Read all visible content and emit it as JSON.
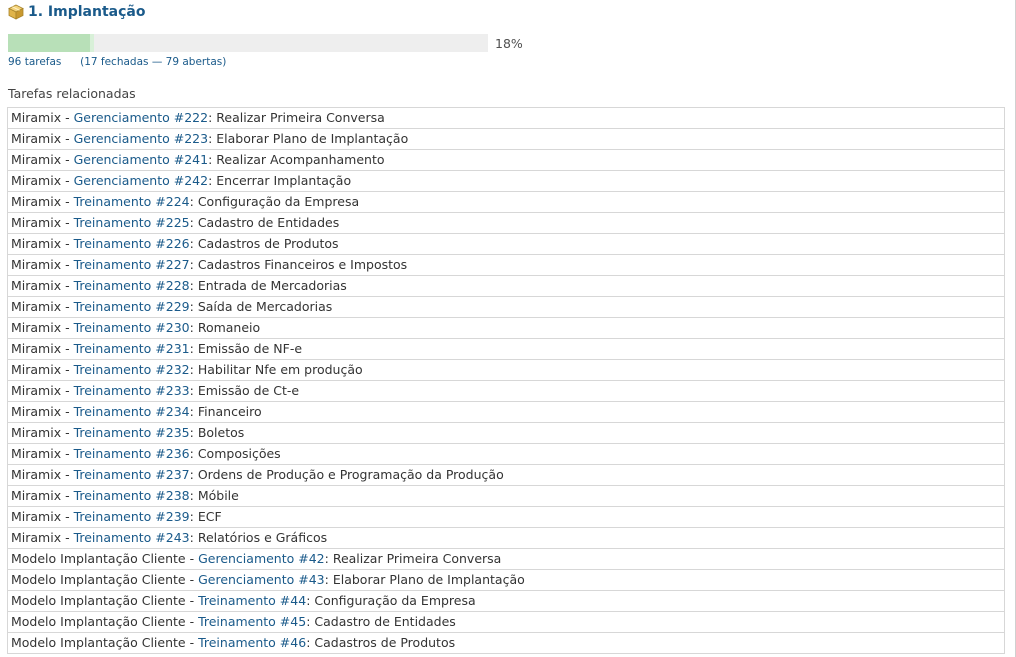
{
  "version": {
    "title": "1. Implantação",
    "icon": "package-icon",
    "progress": {
      "closed_fraction": 0.17,
      "done_fraction": 0.18,
      "percent_label": "18%"
    },
    "counts": {
      "total": "96 tarefas",
      "detail": "(17 fechadas — 79 abertas)"
    }
  },
  "related": {
    "label": "Tarefas relacionadas",
    "rows": [
      {
        "project": "Miramix",
        "tracker_link": "Gerenciamento #222",
        "subject": "Realizar Primeira Conversa"
      },
      {
        "project": "Miramix",
        "tracker_link": "Gerenciamento #223",
        "subject": "Elaborar Plano de Implantação"
      },
      {
        "project": "Miramix",
        "tracker_link": "Gerenciamento #241",
        "subject": "Realizar Acompanhamento"
      },
      {
        "project": "Miramix",
        "tracker_link": "Gerenciamento #242",
        "subject": "Encerrar Implantação"
      },
      {
        "project": "Miramix",
        "tracker_link": "Treinamento #224",
        "subject": "Configuração da Empresa"
      },
      {
        "project": "Miramix",
        "tracker_link": "Treinamento #225",
        "subject": "Cadastro de Entidades"
      },
      {
        "project": "Miramix",
        "tracker_link": "Treinamento #226",
        "subject": "Cadastros de Produtos"
      },
      {
        "project": "Miramix",
        "tracker_link": "Treinamento #227",
        "subject": "Cadastros Financeiros e Impostos"
      },
      {
        "project": "Miramix",
        "tracker_link": "Treinamento #228",
        "subject": "Entrada de Mercadorias"
      },
      {
        "project": "Miramix",
        "tracker_link": "Treinamento #229",
        "subject": "Saída de Mercadorias"
      },
      {
        "project": "Miramix",
        "tracker_link": "Treinamento #230",
        "subject": "Romaneio"
      },
      {
        "project": "Miramix",
        "tracker_link": "Treinamento #231",
        "subject": "Emissão de NF-e"
      },
      {
        "project": "Miramix",
        "tracker_link": "Treinamento #232",
        "subject": "Habilitar Nfe em produção"
      },
      {
        "project": "Miramix",
        "tracker_link": "Treinamento #233",
        "subject": "Emissão de Ct-e"
      },
      {
        "project": "Miramix",
        "tracker_link": "Treinamento #234",
        "subject": "Financeiro"
      },
      {
        "project": "Miramix",
        "tracker_link": "Treinamento #235",
        "subject": "Boletos"
      },
      {
        "project": "Miramix",
        "tracker_link": "Treinamento #236",
        "subject": "Composições"
      },
      {
        "project": "Miramix",
        "tracker_link": "Treinamento #237",
        "subject": "Ordens de Produção e Programação da Produção"
      },
      {
        "project": "Miramix",
        "tracker_link": "Treinamento #238",
        "subject": "Móbile"
      },
      {
        "project": "Miramix",
        "tracker_link": "Treinamento #239",
        "subject": "ECF"
      },
      {
        "project": "Miramix",
        "tracker_link": "Treinamento #243",
        "subject": "Relatórios e Gráficos"
      },
      {
        "project": "Modelo Implantação Cliente",
        "tracker_link": "Gerenciamento #42",
        "subject": "Realizar Primeira Conversa"
      },
      {
        "project": "Modelo Implantação Cliente",
        "tracker_link": "Gerenciamento #43",
        "subject": "Elaborar Plano de Implantação"
      },
      {
        "project": "Modelo Implantação Cliente",
        "tracker_link": "Treinamento #44",
        "subject": "Configuração da Empresa"
      },
      {
        "project": "Modelo Implantação Cliente",
        "tracker_link": "Treinamento #45",
        "subject": "Cadastro de Entidades"
      },
      {
        "project": "Modelo Implantação Cliente",
        "tracker_link": "Treinamento #46",
        "subject": "Cadastros de Produtos"
      }
    ]
  },
  "colors": {
    "link": "#1a5a8a",
    "progress_closed": "#b8e0b8",
    "progress_done": "#d8f0d8",
    "progress_track": "#eeeeee"
  }
}
